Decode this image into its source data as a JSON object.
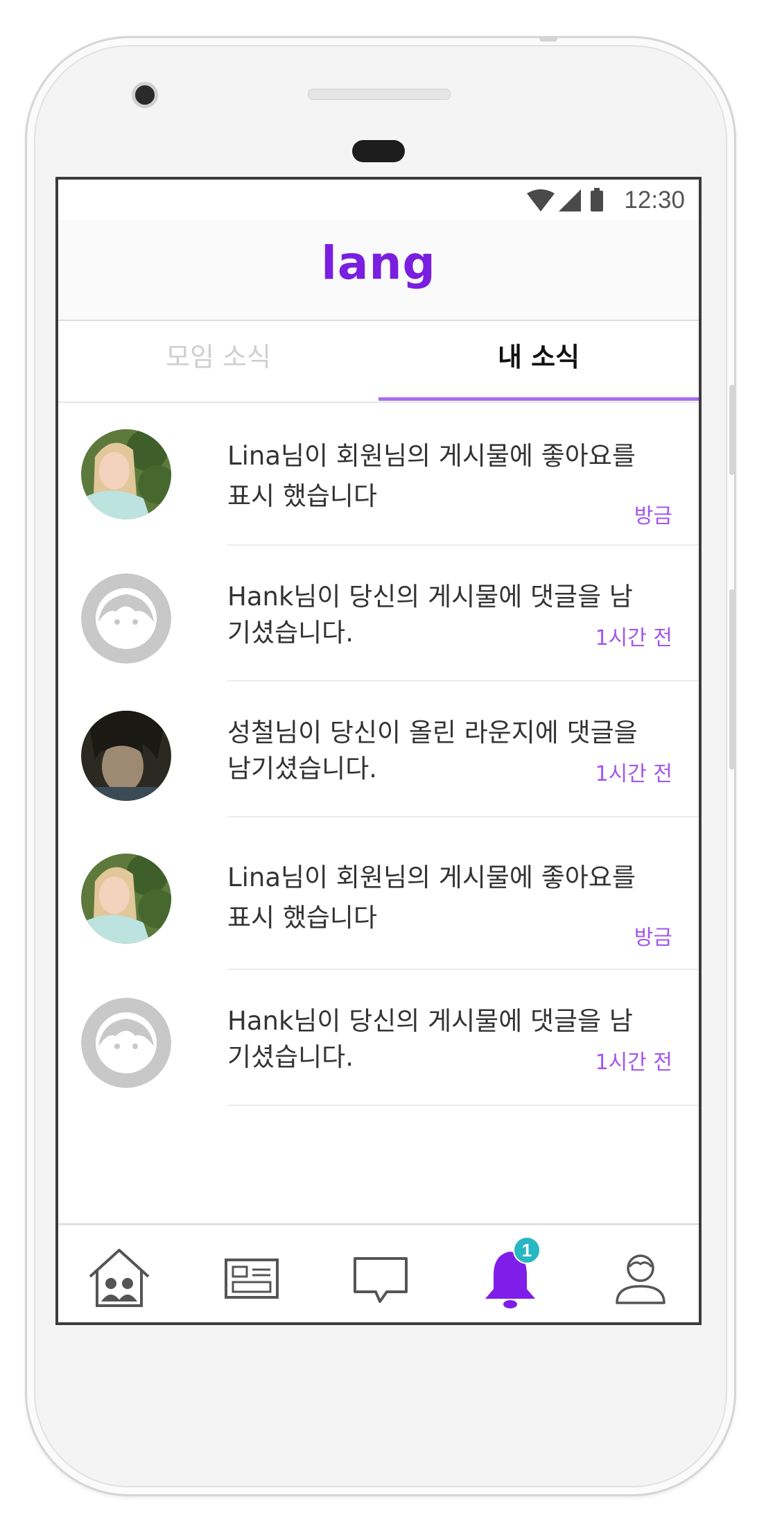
{
  "status_bar": {
    "time": "12:30"
  },
  "app": {
    "logo_text": "lang",
    "brand_color": "#7a1fe0",
    "accent_color": "#a66cf0"
  },
  "tabs": [
    {
      "label": "모임 소식",
      "active": false
    },
    {
      "label": "내 소식",
      "active": true
    }
  ],
  "notifications": [
    {
      "avatar": "photo-blonde-girl",
      "line1": "Lina님이 회원님의 게시물에 좋아요를",
      "line2": "표시 했습니다",
      "time": "방금"
    },
    {
      "avatar": "default-avatar",
      "line1": "Hank님이 당신의 게시물에 댓글을 남",
      "line2": "기셨습니다.",
      "time": "1시간 전"
    },
    {
      "avatar": "photo-dark-hair-boy",
      "line1": "성철님이 당신이 올린 라운지에 댓글을",
      "line2": "남기셨습니다.",
      "time": "1시간 전"
    },
    {
      "avatar": "photo-blonde-girl",
      "line1": "Lina님이 회원님의 게시물에 좋아요를",
      "line2": "표시 했습니다",
      "time": "방금"
    },
    {
      "avatar": "default-avatar",
      "line1": "Hank님이 당신의 게시물에 댓글을 남",
      "line2": "기셨습니다.",
      "time": "1시간 전"
    }
  ],
  "bottom_nav": [
    {
      "icon": "home-group-icon",
      "active": false
    },
    {
      "icon": "board-icon",
      "active": false
    },
    {
      "icon": "chat-icon",
      "active": false
    },
    {
      "icon": "bell-icon",
      "active": true,
      "badge": "1"
    },
    {
      "icon": "profile-icon",
      "active": false
    }
  ]
}
